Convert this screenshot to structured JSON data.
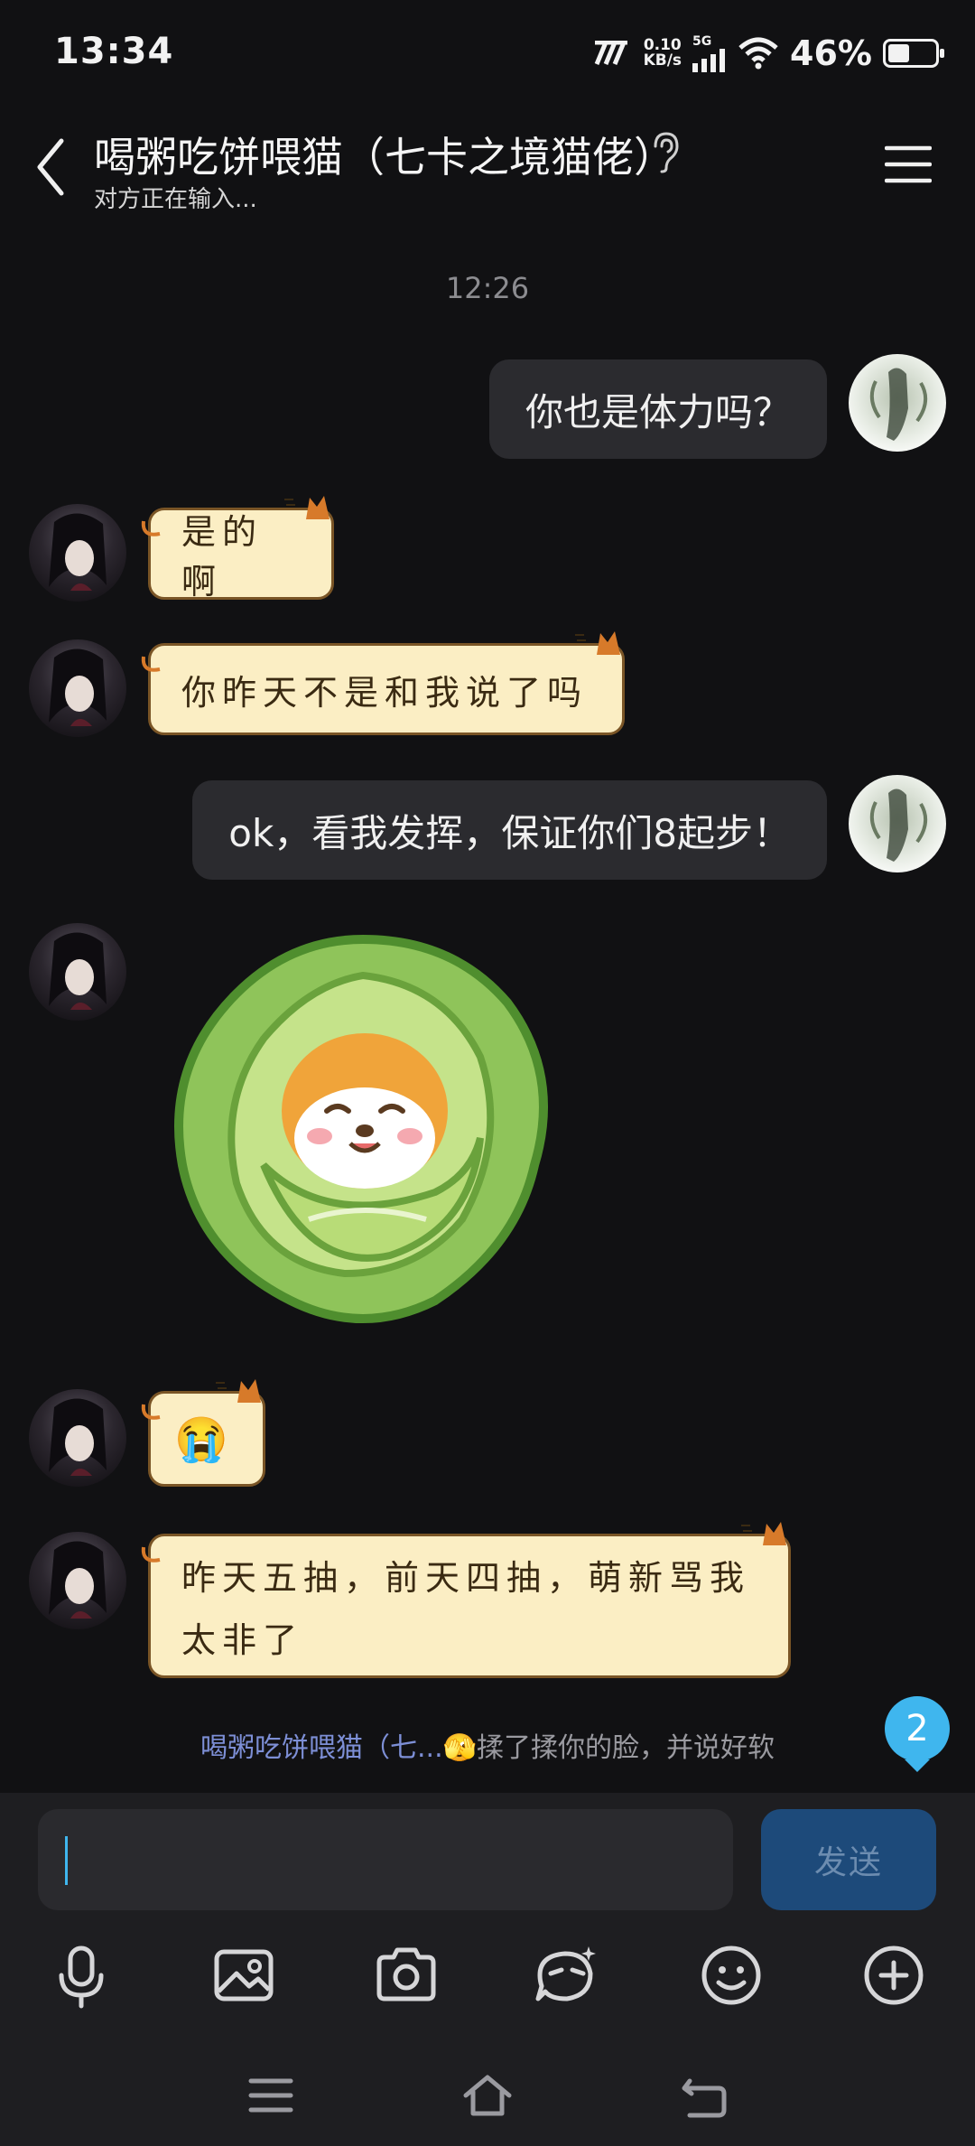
{
  "status_bar": {
    "time": "13:34",
    "net_speed_value": "0.10",
    "net_speed_unit": "KB/s",
    "network_type": "5G",
    "battery_percent": "46%",
    "battery_level": 0.46
  },
  "header": {
    "title": "喝粥吃饼喂猫（七卡之境猫佬）",
    "subtitle": "对方正在输入..."
  },
  "chat": {
    "timestamp": "12:26",
    "messages": [
      {
        "side": "right",
        "type": "text",
        "text": "你也是体力吗？"
      },
      {
        "side": "left",
        "type": "text",
        "text": "是的啊"
      },
      {
        "side": "left",
        "type": "text",
        "text": "你昨天不是和我说了吗"
      },
      {
        "side": "right",
        "type": "text",
        "text": "ok，看我发挥，保证你们8起步！"
      },
      {
        "side": "left",
        "type": "sticker",
        "sticker": "cabbage-shiba-sticker"
      },
      {
        "side": "left",
        "type": "emoji",
        "text": "😭"
      },
      {
        "side": "left",
        "type": "text",
        "line1": "昨天五抽，前天四抽，萌新骂我",
        "line2": "太非了"
      }
    ],
    "notice": {
      "actor": "喝粥吃饼喂猫（七...",
      "emoji": "🫣",
      "action": "揉了揉你的脸，并说好软"
    },
    "unread_count": "2"
  },
  "input": {
    "value": "",
    "send_label": "发送"
  },
  "toolbar": {
    "icons": [
      "microphone-icon",
      "image-icon",
      "camera-icon",
      "sticker-icon",
      "emoji-icon",
      "plus-icon"
    ]
  },
  "navbar": {
    "icons": [
      "menu-icon",
      "home-icon",
      "back-icon"
    ]
  },
  "colors": {
    "background": "#111113",
    "my_bubble": "#2b2b2f",
    "paper_bubble": "#fbeec4",
    "accent": "#3fb6ee",
    "send_button": "#1d4a7a"
  }
}
